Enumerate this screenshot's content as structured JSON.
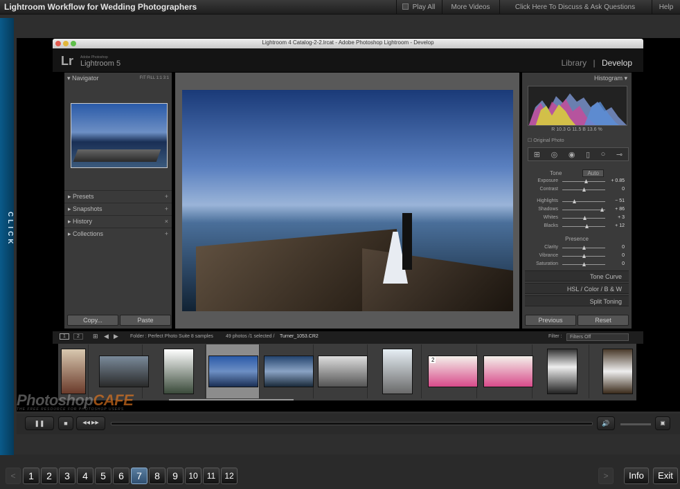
{
  "course_title": "Lightroom Workflow for Wedding Photographers",
  "top_buttons": {
    "play_all": "Play All",
    "more_videos": "More Videos",
    "discuss": "Click Here To Discuss & Ask Questions",
    "help": "Help"
  },
  "side_tab": "CLICK",
  "app": {
    "window_title": "Lightroom 4 Catalog-2-2.lrcat - Adobe Photoshop Lightroom - Develop",
    "logo": "Lr",
    "brand_small": "Adobe Photoshop",
    "brand": "Lightroom 5",
    "modules": {
      "library": "Library",
      "sep": "|",
      "develop": "Develop"
    }
  },
  "left_panel": {
    "navigator": "Navigator",
    "zoom_options": "FIT  FILL  1:1  3:1",
    "items": [
      {
        "label": "Presets",
        "icon": "+"
      },
      {
        "label": "Snapshots",
        "icon": "+"
      },
      {
        "label": "History",
        "icon": "×"
      },
      {
        "label": "Collections",
        "icon": "+"
      }
    ],
    "copy_button": "Copy...",
    "paste_button": "Paste"
  },
  "right_panel": {
    "histogram": "Histogram",
    "rgb_readout": "R  10.3   G  11.5   B  13.6 %",
    "original_photo": "Original Photo",
    "tone": "Tone",
    "auto": "Auto",
    "sliders": [
      {
        "label": "Exposure",
        "value": "+ 0.85",
        "pos": 0.55
      },
      {
        "label": "Contrast",
        "value": "0",
        "pos": 0.5
      },
      {
        "label": "Highlights",
        "value": "− 51",
        "pos": 0.28
      },
      {
        "label": "Shadows",
        "value": "+ 86",
        "pos": 0.92
      },
      {
        "label": "Whites",
        "value": "+ 3",
        "pos": 0.52
      },
      {
        "label": "Blacks",
        "value": "+ 12",
        "pos": 0.56
      }
    ],
    "presence": "Presence",
    "presence_sliders": [
      {
        "label": "Clarity",
        "value": "0",
        "pos": 0.5
      },
      {
        "label": "Vibrance",
        "value": "0",
        "pos": 0.5
      },
      {
        "label": "Saturation",
        "value": "0",
        "pos": 0.5
      }
    ],
    "tone_curve": "Tone Curve",
    "hsl": "HSL  /  Color  /  B & W",
    "split_toning": "Split Toning",
    "previous_button": "Previous",
    "reset_button": "Reset"
  },
  "filmstrip": {
    "page1": "1",
    "page2": "2",
    "folder": "Folder : Perfect Photo Suite 8 samples",
    "count": "49 photos /1 selected /",
    "filename": "Turner_1053.CR2",
    "filter_label": "Filter :",
    "filter_value": "Filters Off",
    "badge": "2"
  },
  "watermark": {
    "part1": "Photoshop",
    "part2": "CAFE",
    "tagline": "THE FREE RESOURCE FOR PHOTOSHOP USERS"
  },
  "player": {
    "pause": "❚❚",
    "stop": "■",
    "rewind": "◀◀",
    "forward": "▶▶"
  },
  "pagination": {
    "prev": "<",
    "next": ">",
    "pages": [
      "1",
      "2",
      "3",
      "4",
      "5",
      "6",
      "7",
      "8",
      "9",
      "10",
      "11",
      "12"
    ],
    "current": "7",
    "info": "Info",
    "exit": "Exit"
  }
}
